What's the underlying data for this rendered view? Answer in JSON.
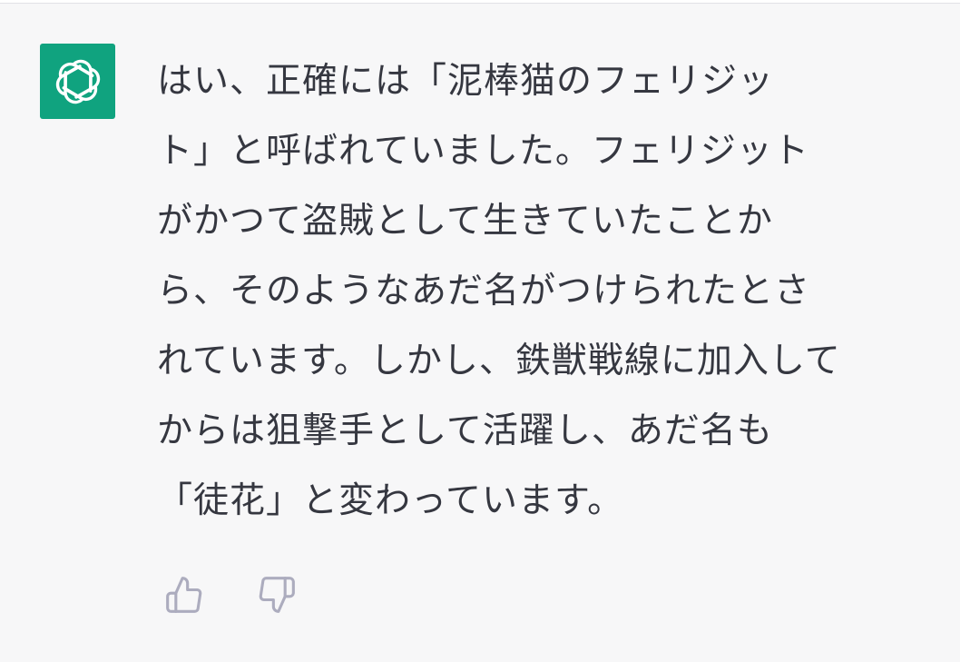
{
  "colors": {
    "avatar_bg": "#10a37f",
    "row_bg": "#f7f7f8",
    "text": "#353740",
    "icon": "#acacbe"
  },
  "assistant": {
    "avatar_icon": "openai-logo-icon"
  },
  "message": {
    "lines": [
      "はい、正確には「泥棒猫のフェリジッ",
      "ト」と呼ばれていました。フェリジット",
      "がかつて盗賊として生きていたことか",
      "ら、そのようなあだ名がつけられたとさ",
      "れています。しかし、鉄獣戦線に加入して",
      "からは狙撃手として活躍し、あだ名も",
      "「徒花」と変わっています。"
    ]
  },
  "feedback": {
    "thumbs_up_icon": "thumbs-up-icon",
    "thumbs_down_icon": "thumbs-down-icon"
  }
}
